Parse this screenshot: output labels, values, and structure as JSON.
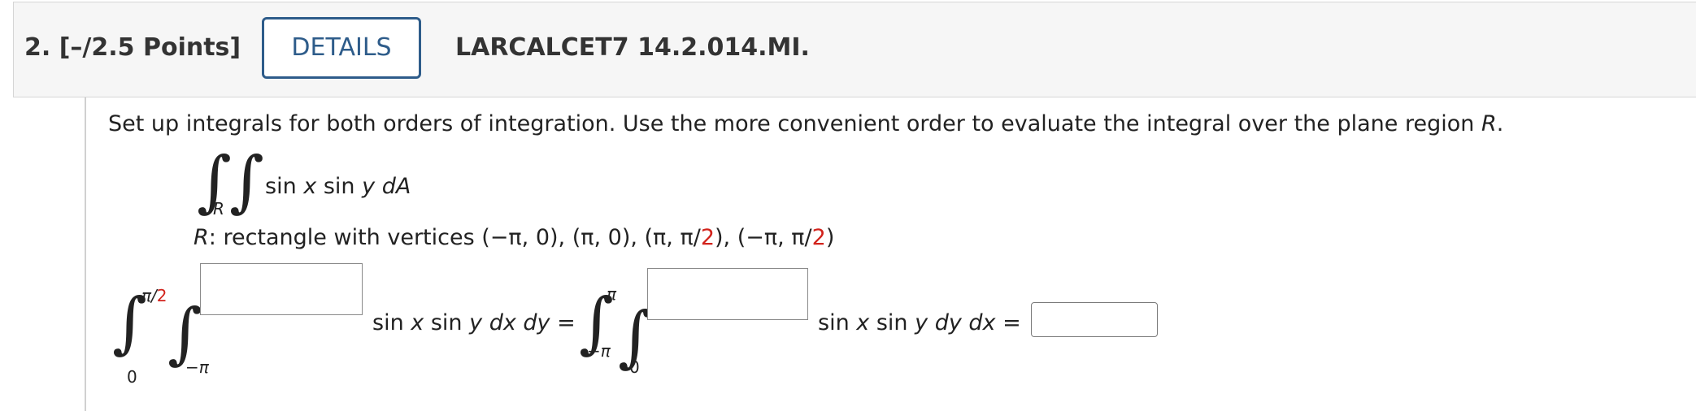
{
  "header": {
    "question_label": "2. [–/2.5 Points]",
    "details_button": "DETAILS",
    "course_id": "LARCALCET7 14.2.014.MI."
  },
  "problem": {
    "instructions_prefix": "Set up integrals for both orders of integration. Use the more convenient order to evaluate the integral over the plane region ",
    "region_var": "R",
    "instructions_suffix": ".",
    "double_integral": {
      "region_subscript": "R",
      "integrand_func": "sin ",
      "x": "x",
      "mid": " sin ",
      "y": "y",
      "dA": "dA"
    },
    "region_desc": {
      "var": "R",
      "text": ": rectangle with vertices (−π, 0), (π, 0), (π, π/",
      "two_a": "2",
      "mid": "), (−π, π/",
      "two_b": "2",
      "end": ")"
    }
  },
  "order_dxdy": {
    "outer_upper_prefix": "π/",
    "outer_upper_red": "2",
    "outer_lower": "0",
    "inner_lower": "−π",
    "inner_upper_value": "",
    "integrand_a": "sin ",
    "x": "x",
    "integrand_b": " sin ",
    "y": "y",
    "differential": "dx dy",
    "equals": "="
  },
  "order_dydx": {
    "outer_upper": "π",
    "outer_lower": "−π",
    "inner_lower": "0",
    "inner_upper_value": "",
    "integrand_a": "sin ",
    "x": "x",
    "integrand_b": " sin ",
    "y": "y",
    "differential": "dy dx",
    "equals": "="
  },
  "final_answer_value": "",
  "colors": {
    "accent_blue": "#2e5c8a",
    "highlight_red": "#d2231c",
    "header_bg": "#f6f6f6"
  }
}
